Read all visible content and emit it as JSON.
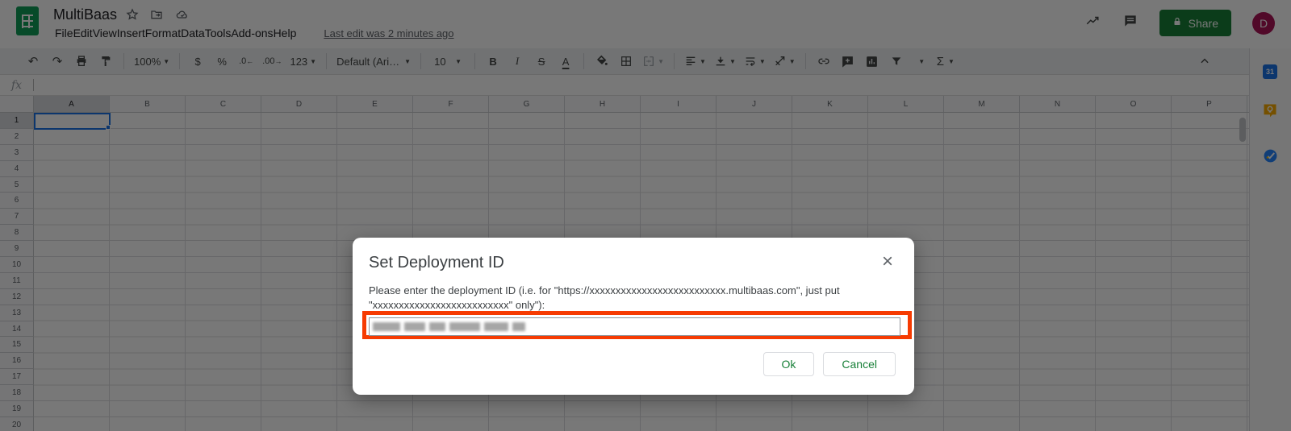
{
  "app": {
    "title": "MultiBaas",
    "menu": [
      "File",
      "Edit",
      "View",
      "Insert",
      "Format",
      "Data",
      "Tools",
      "Add-ons",
      "Help"
    ],
    "last_edit": "Last edit was 2 minutes ago",
    "share_label": "Share",
    "avatar_initial": "D"
  },
  "toolbar": {
    "zoom": "100%",
    "currency": "$",
    "percent": "%",
    "decrease_decimal": ".0",
    "increase_decimal": ".00",
    "more_formats": "123",
    "font_family": "Default (Ari…",
    "font_size": "10",
    "bold": "B",
    "italic": "I",
    "strikethrough": "S",
    "text_color": "A",
    "functions": "Σ"
  },
  "formula_bar": {
    "fx": "fx"
  },
  "grid": {
    "columns": [
      "A",
      "B",
      "C",
      "D",
      "E",
      "F",
      "G",
      "H",
      "I",
      "J",
      "K",
      "L",
      "M",
      "N",
      "O",
      "P"
    ],
    "rows": [
      "1",
      "2",
      "3",
      "4",
      "5",
      "6",
      "7",
      "8",
      "9",
      "10",
      "11",
      "12",
      "13",
      "14",
      "15",
      "16",
      "17",
      "18",
      "19",
      "20"
    ],
    "selected_cell": "A1"
  },
  "sidebar": {
    "calendar_label": "31",
    "icons": [
      "calendar",
      "keep",
      "tasks"
    ]
  },
  "dialog": {
    "title": "Set Deployment ID",
    "close": "×",
    "body_line1": "Please enter the deployment ID (i.e. for \"https://xxxxxxxxxxxxxxxxxxxxxxxxxx.multibaas.com\", just put",
    "body_line2": "\"xxxxxxxxxxxxxxxxxxxxxxxxxx\" only\"):",
    "input": {
      "value_redacted": true
    },
    "ok_label": "Ok",
    "cancel_label": "Cancel"
  },
  "colors": {
    "share_green": "#188038",
    "dialog_button_green": "#188038",
    "highlight_red": "#f63b02",
    "selection_blue": "#1a73e8",
    "avatar_pink": "#ad1457",
    "sheets_green": "#0f9d58"
  }
}
